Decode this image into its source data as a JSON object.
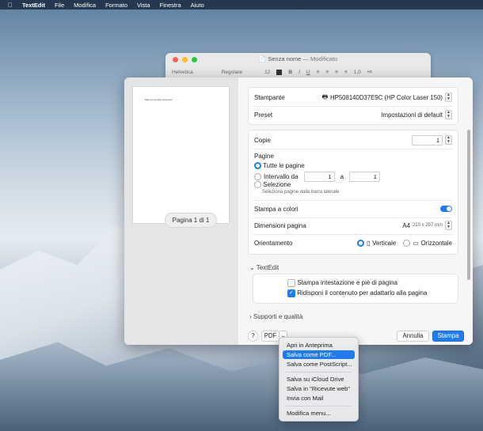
{
  "menubar": {
    "apple": "",
    "app": "TextEdit",
    "items": [
      "File",
      "Modifica",
      "Formato",
      "Vista",
      "Finestra",
      "Aiuto"
    ]
  },
  "textedit_window": {
    "title": "Senza nome",
    "subtitle": "— Modificato",
    "toolbar": {
      "font": "Helvetica",
      "style": "Regolare",
      "size": "12",
      "spacing": "1,0"
    }
  },
  "print_dialog": {
    "preview": {
      "page_text": "Dati con un testo d'esempio",
      "page_indicator": "Pagina 1 di 1"
    },
    "printer": {
      "label": "Stampante",
      "value": "HP508140D37E9C (HP Color Laser 150)"
    },
    "preset": {
      "label": "Preset",
      "value": "Impostazioni di default"
    },
    "copies": {
      "label": "Copie",
      "value": "1"
    },
    "pages": {
      "label": "Pagine",
      "all_label": "Tutte le pagine",
      "range_label": "Intervallo da",
      "from": "1",
      "to_label": "a",
      "to": "1",
      "selection_label": "Selezione",
      "selection_hint": "Seleziona pagine dalla barra laterale"
    },
    "color": {
      "label": "Stampa a colori"
    },
    "paper": {
      "label": "Dimensioni pagina",
      "size": "A4",
      "dims": "210 x 297 mm"
    },
    "orientation": {
      "label": "Orientamento",
      "portrait": "Verticale",
      "landscape": "Orizzontale"
    },
    "textedit_section": {
      "label": "TextEdit",
      "header_footer": "Stampa intestazione e piè di pagina",
      "rewrap": "Ridisponi il contenuto per adattarlo alla pagina"
    },
    "next_section": "Supporti e qualità",
    "footer": {
      "help": "?",
      "pdf": "PDF",
      "cancel": "Annulla",
      "print": "Stampa"
    }
  },
  "pdf_menu": {
    "items": [
      "Apri in Anteprima",
      "Salva come PDF...",
      "Salva come PostScript...",
      "Salva su iCloud Drive",
      "Salva in \"Ricevute web\"",
      "Invia con Mail",
      "Modifica menu..."
    ]
  },
  "colors": {
    "accent": "#1f7cf0"
  }
}
